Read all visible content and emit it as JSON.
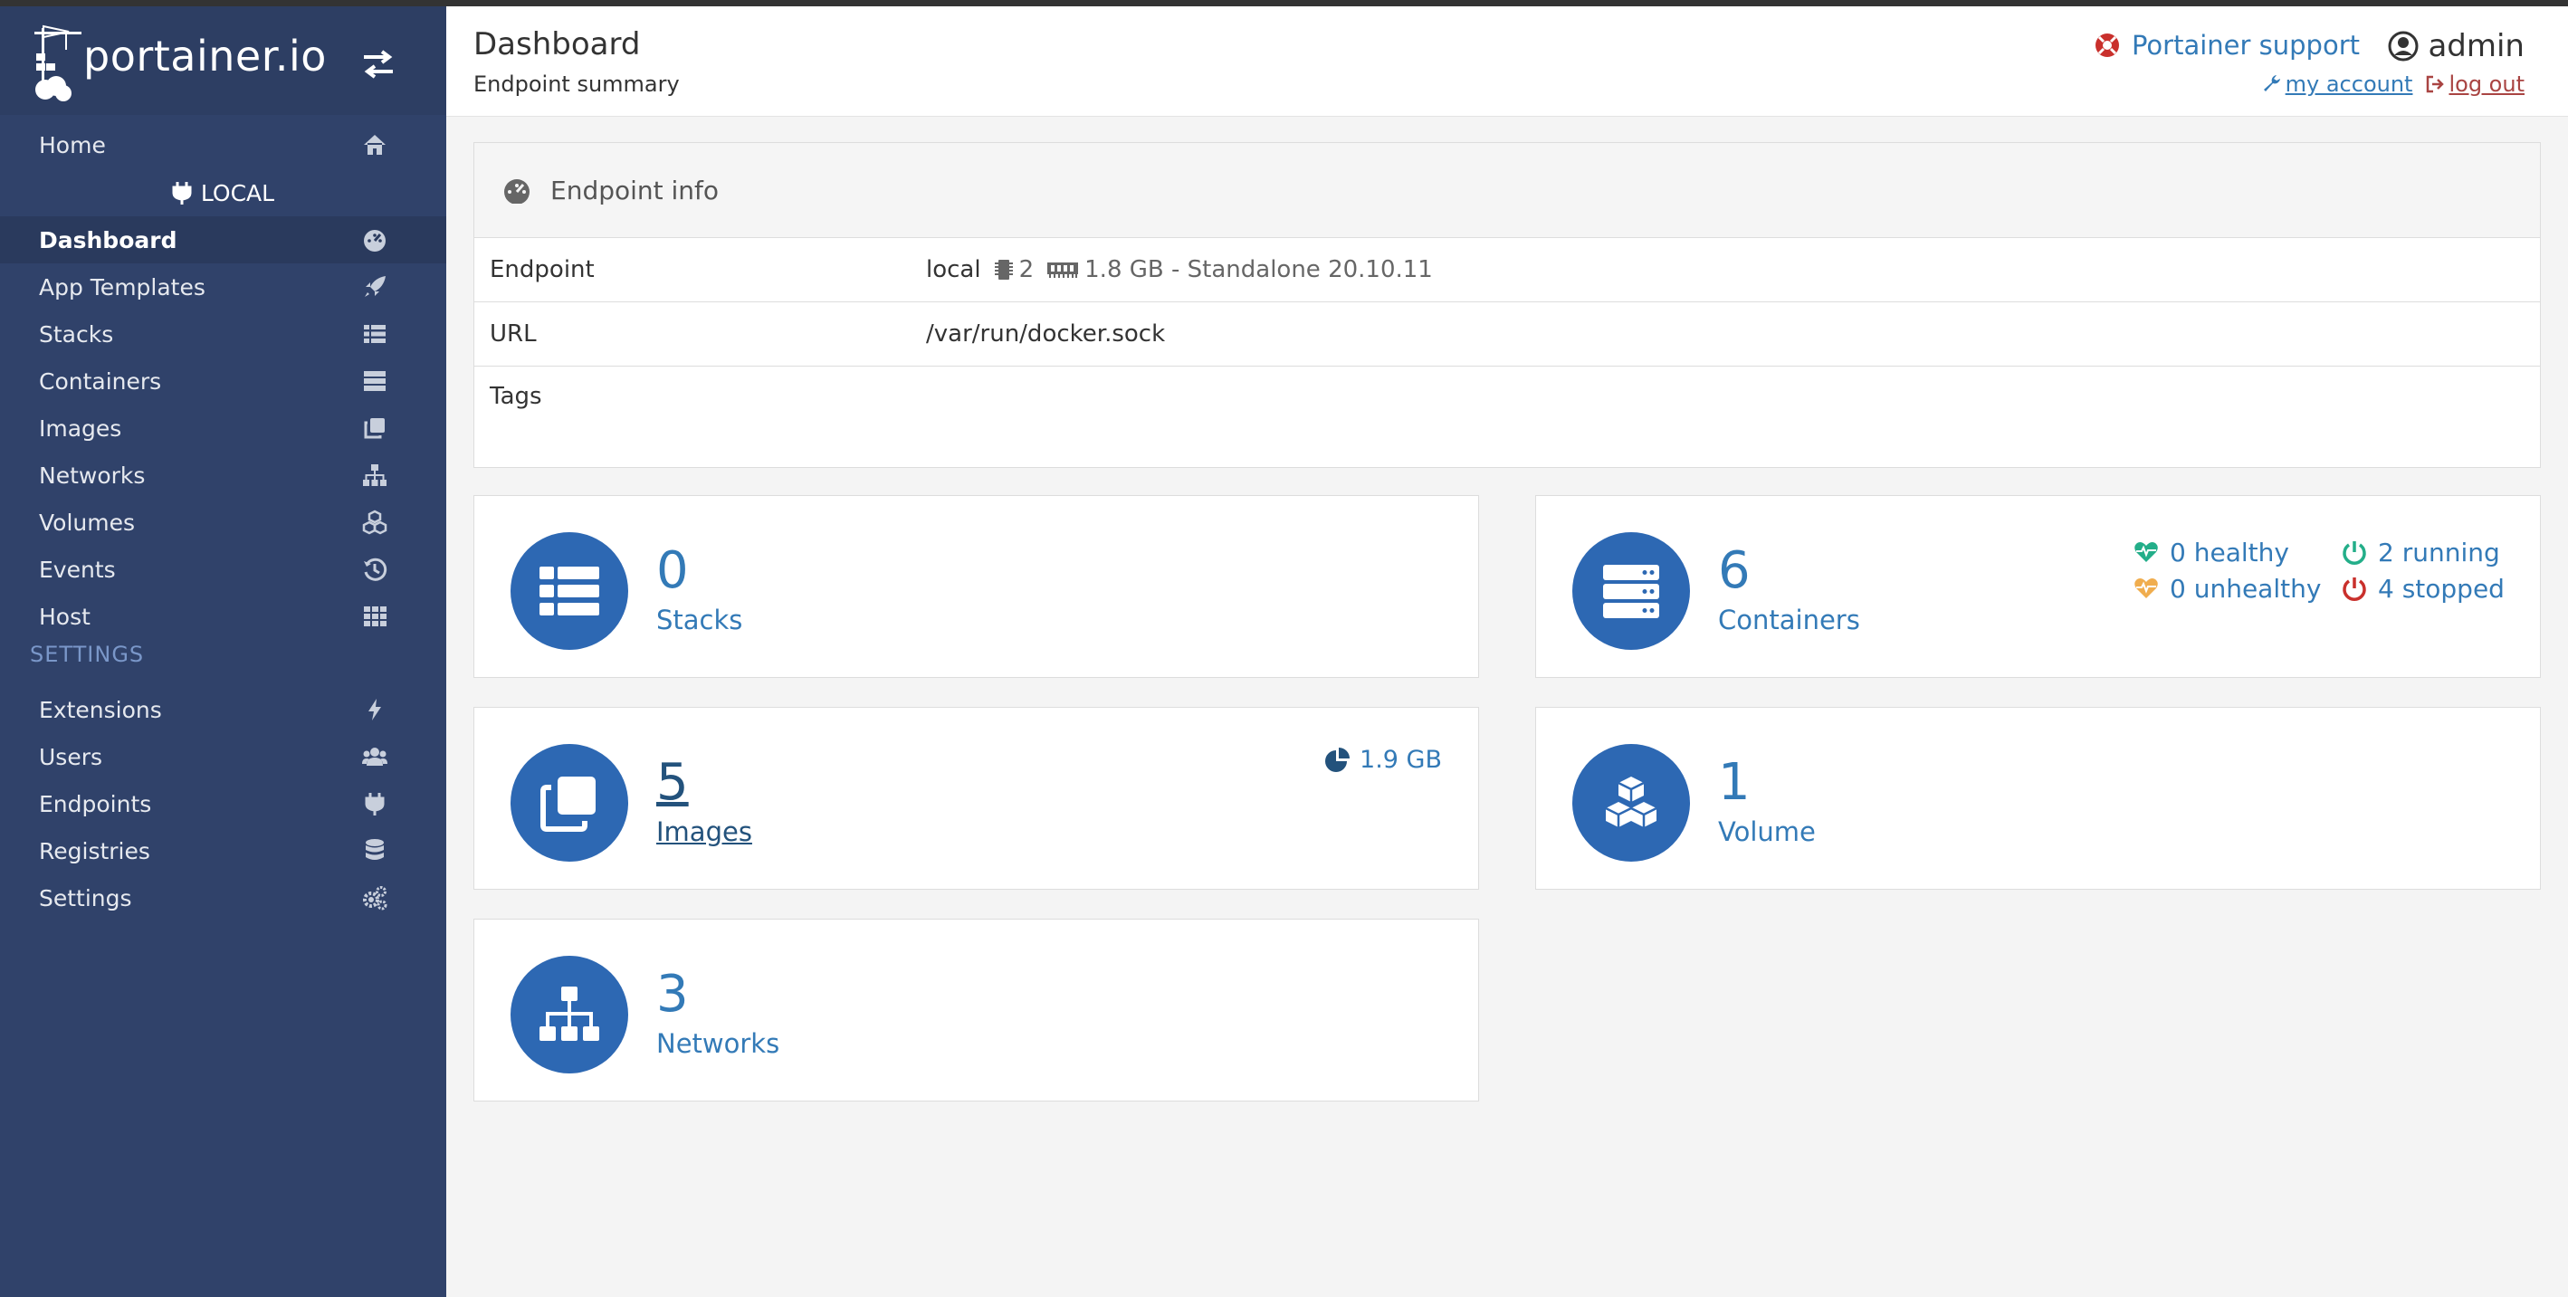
{
  "brand": {
    "name": "portainer.io"
  },
  "sidebar": {
    "home": {
      "label": "Home",
      "icon": "home-icon"
    },
    "endpoint": {
      "label": "LOCAL",
      "icon": "plug-icon"
    },
    "items": [
      {
        "label": "Dashboard",
        "icon": "tachometer-icon",
        "active": true
      },
      {
        "label": "App Templates",
        "icon": "rocket-icon"
      },
      {
        "label": "Stacks",
        "icon": "th-list-icon"
      },
      {
        "label": "Containers",
        "icon": "server-icon"
      },
      {
        "label": "Images",
        "icon": "clone-icon"
      },
      {
        "label": "Networks",
        "icon": "sitemap-icon"
      },
      {
        "label": "Volumes",
        "icon": "cubes-icon"
      },
      {
        "label": "Events",
        "icon": "history-icon"
      },
      {
        "label": "Host",
        "icon": "th-icon"
      }
    ],
    "settings_title": "SETTINGS",
    "settings_items": [
      {
        "label": "Extensions",
        "icon": "bolt-icon"
      },
      {
        "label": "Users",
        "icon": "users-icon"
      },
      {
        "label": "Endpoints",
        "icon": "plug-icon"
      },
      {
        "label": "Registries",
        "icon": "database-icon"
      },
      {
        "label": "Settings",
        "icon": "cogs-icon"
      }
    ]
  },
  "header": {
    "title": "Dashboard",
    "subtitle": "Endpoint summary",
    "support": "Portainer support",
    "user": "admin",
    "my_account": " my account ",
    "log_out": " log out"
  },
  "endpoint_info": {
    "heading": "Endpoint info",
    "rows": {
      "endpoint": {
        "key": "Endpoint",
        "name": "local",
        "cpu": "2",
        "memory": "1.8 GB - Standalone 20.10.11"
      },
      "url": {
        "key": "URL",
        "value": "/var/run/docker.sock"
      },
      "tags": {
        "key": "Tags",
        "value": ""
      }
    }
  },
  "widgets": {
    "stacks": {
      "count": "0",
      "label": "Stacks"
    },
    "containers": {
      "count": "6",
      "label": "Containers",
      "healthy": "0 healthy",
      "unhealthy": "0 unhealthy",
      "running": "2 running",
      "stopped": "4 stopped"
    },
    "images": {
      "count": "5",
      "label": "Images",
      "size": "1.9 GB"
    },
    "volumes": {
      "count": "1",
      "label": "Volume"
    },
    "networks": {
      "count": "3",
      "label": "Networks"
    }
  },
  "colors": {
    "sidebar": "#30426a",
    "accent": "#337ab7",
    "widget_icon": "#2d68b3",
    "healthy": "#23ae89",
    "unhealthy": "#f0ad4e",
    "running": "#23ae89",
    "stopped": "#c9302c",
    "logout": "#a94442"
  }
}
